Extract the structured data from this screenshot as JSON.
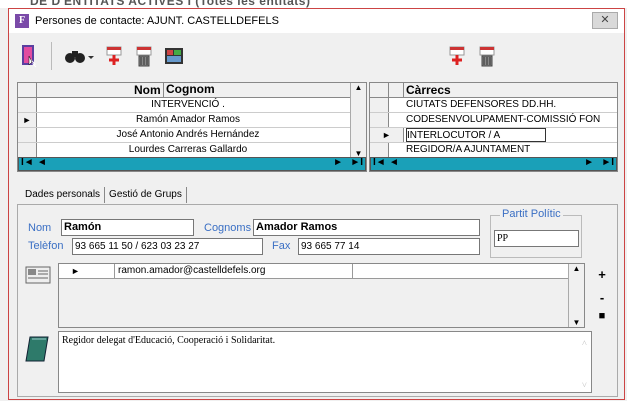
{
  "background_title": "DE D'ENTITATS ACTIVES I (Totes les entitats)",
  "window": {
    "app_icon": "F",
    "title": "Persones de contacte: AJUNT. CASTELLDEFELS",
    "close": "✕"
  },
  "contacts_grid": {
    "headers": {
      "name": "Nom",
      "surname": "Cognom"
    },
    "rows": [
      {
        "indicator": "",
        "text": "INTERVENCIÓ ."
      },
      {
        "indicator": "►",
        "text": "Ramón Amador Ramos"
      },
      {
        "indicator": "",
        "text": "José Antonio Andrés Hernández"
      },
      {
        "indicator": "",
        "text": "Lourdes Carreras Gallardo"
      }
    ],
    "nav": {
      "first": "I◄",
      "prev": "◄",
      "next": "►",
      "last": "►I"
    }
  },
  "positions_grid": {
    "header": "Càrrecs",
    "rows": [
      {
        "indicator": "",
        "text": "CIUTATS DEFENSORES DD.HH."
      },
      {
        "indicator": "",
        "text": "CODESENVOLUPAMENT-COMISSIÓ FON"
      },
      {
        "indicator": "►",
        "text": "INTERLOCUTOR / A"
      },
      {
        "indicator": "",
        "text": "REGIDOR/A AJUNTAMENT"
      }
    ],
    "nav": {
      "first": "I◄",
      "prev": "◄",
      "next": "►",
      "last": "►I"
    }
  },
  "tabs": [
    {
      "label": "Dades personals"
    },
    {
      "label": "Gestió de Grups"
    }
  ],
  "form": {
    "name_label": "Nom",
    "name_value": "Ramón",
    "surname_label": "Cognoms",
    "surname_value": "Amador Ramos",
    "phone_label": "Telèfon",
    "phone_value": "93 665 11 50 / 623 03 23 27",
    "fax_label": "Fax",
    "fax_value": "93 665 77 14",
    "party_label": "Partit Polític",
    "party_value": "PP",
    "email_indicator": "►",
    "email_value": "ramon.amador@castelldefels.org",
    "add_btn": "+",
    "remove_btn": "-",
    "save_btn": "■",
    "notes": "Regidor delegat d'Educació, Cooperació i Solidaritat."
  },
  "colors": {
    "nav_bar": "#1aa0b8",
    "label_blue": "#3a6fc4"
  }
}
